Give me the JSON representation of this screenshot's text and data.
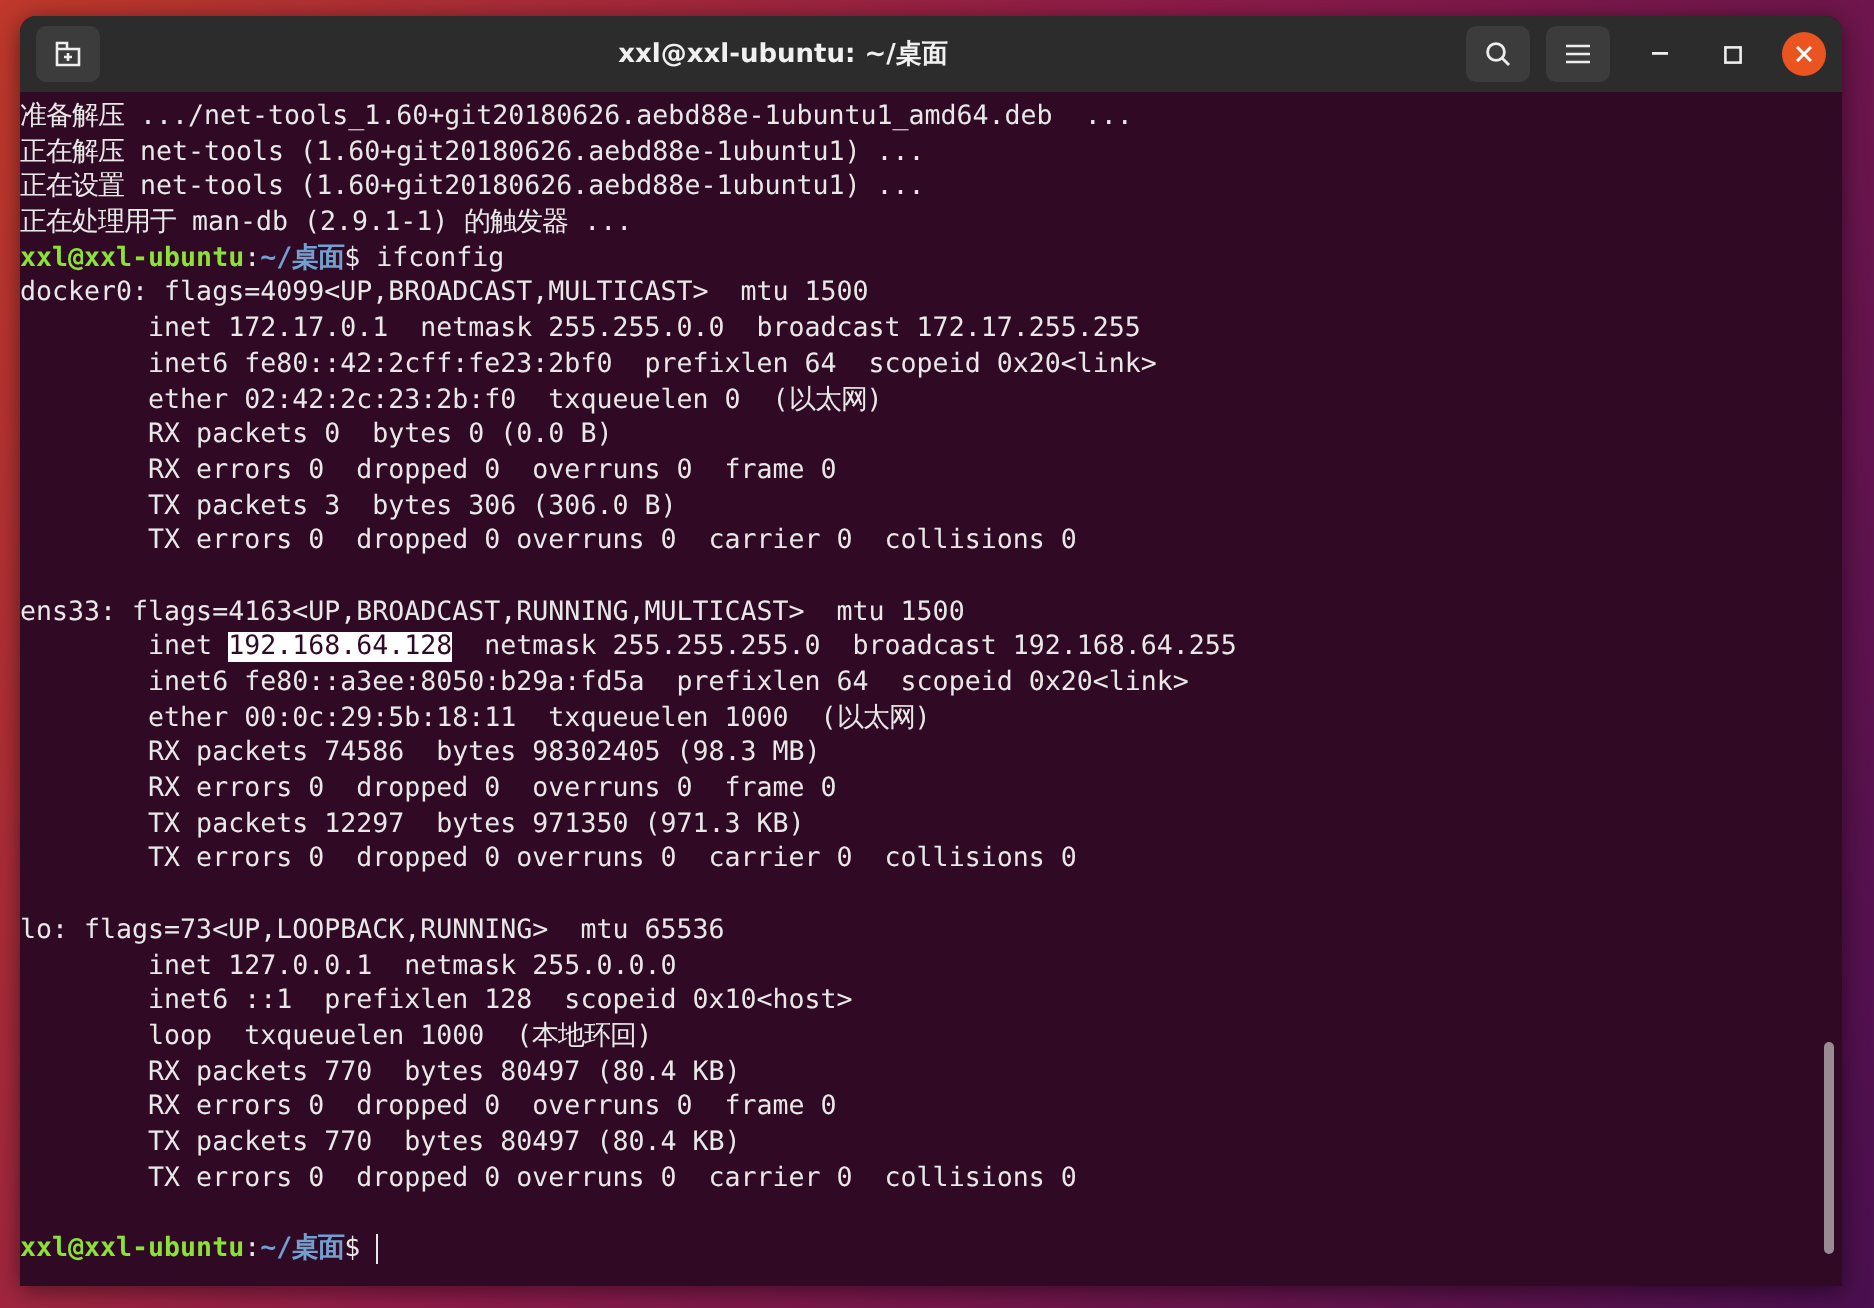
{
  "window": {
    "title": "xxl@xxl-ubuntu: ~/桌面"
  },
  "lines": [
    {
      "kind": "text",
      "segments": [
        {
          "kind": "plain",
          "text": "准备解压 .../net-tools_1.60+git20180626.aebd88e-1ubuntu1_amd64.deb  ..."
        }
      ]
    },
    {
      "kind": "text",
      "segments": [
        {
          "kind": "plain",
          "text": "正在解压 net-tools (1.60+git20180626.aebd88e-1ubuntu1) ..."
        }
      ]
    },
    {
      "kind": "text",
      "segments": [
        {
          "kind": "plain",
          "text": "正在设置 net-tools (1.60+git20180626.aebd88e-1ubuntu1) ..."
        }
      ]
    },
    {
      "kind": "text",
      "segments": [
        {
          "kind": "plain",
          "text": "正在处理用于 man-db (2.9.1-1) 的触发器 ..."
        }
      ]
    },
    {
      "kind": "text",
      "segments": [
        {
          "kind": "user",
          "text": "xxl@xxl-ubuntu"
        },
        {
          "kind": "plain",
          "text": ":"
        },
        {
          "kind": "path",
          "text": "~/桌面"
        },
        {
          "kind": "plain",
          "text": "$ ifconfig"
        }
      ]
    },
    {
      "kind": "text",
      "segments": [
        {
          "kind": "plain",
          "text": "docker0: flags=4099<UP,BROADCAST,MULTICAST>  mtu 1500"
        }
      ]
    },
    {
      "kind": "text",
      "segments": [
        {
          "kind": "plain",
          "text": "        inet 172.17.0.1  netmask 255.255.0.0  broadcast 172.17.255.255"
        }
      ]
    },
    {
      "kind": "text",
      "segments": [
        {
          "kind": "plain",
          "text": "        inet6 fe80::42:2cff:fe23:2bf0  prefixlen 64  scopeid 0x20<link>"
        }
      ]
    },
    {
      "kind": "text",
      "segments": [
        {
          "kind": "plain",
          "text": "        ether 02:42:2c:23:2b:f0  txqueuelen 0  (以太网)"
        }
      ]
    },
    {
      "kind": "text",
      "segments": [
        {
          "kind": "plain",
          "text": "        RX packets 0  bytes 0 (0.0 B)"
        }
      ]
    },
    {
      "kind": "text",
      "segments": [
        {
          "kind": "plain",
          "text": "        RX errors 0  dropped 0  overruns 0  frame 0"
        }
      ]
    },
    {
      "kind": "text",
      "segments": [
        {
          "kind": "plain",
          "text": "        TX packets 3  bytes 306 (306.0 B)"
        }
      ]
    },
    {
      "kind": "text",
      "segments": [
        {
          "kind": "plain",
          "text": "        TX errors 0  dropped 0 overruns 0  carrier 0  collisions 0"
        }
      ]
    },
    {
      "kind": "blank"
    },
    {
      "kind": "text",
      "segments": [
        {
          "kind": "plain",
          "text": "ens33: flags=4163<UP,BROADCAST,RUNNING,MULTICAST>  mtu 1500"
        }
      ]
    },
    {
      "kind": "text",
      "segments": [
        {
          "kind": "plain",
          "text": "        inet "
        },
        {
          "kind": "selection",
          "text": "192.168.64.128"
        },
        {
          "kind": "plain",
          "text": "  netmask 255.255.255.0  broadcast 192.168.64.255"
        }
      ]
    },
    {
      "kind": "text",
      "segments": [
        {
          "kind": "plain",
          "text": "        inet6 fe80::a3ee:8050:b29a:fd5a  prefixlen 64  scopeid 0x20<link>"
        }
      ]
    },
    {
      "kind": "text",
      "segments": [
        {
          "kind": "plain",
          "text": "        ether 00:0c:29:5b:18:11  txqueuelen 1000  (以太网)"
        }
      ]
    },
    {
      "kind": "text",
      "segments": [
        {
          "kind": "plain",
          "text": "        RX packets 74586  bytes 98302405 (98.3 MB)"
        }
      ]
    },
    {
      "kind": "text",
      "segments": [
        {
          "kind": "plain",
          "text": "        RX errors 0  dropped 0  overruns 0  frame 0"
        }
      ]
    },
    {
      "kind": "text",
      "segments": [
        {
          "kind": "plain",
          "text": "        TX packets 12297  bytes 971350 (971.3 KB)"
        }
      ]
    },
    {
      "kind": "text",
      "segments": [
        {
          "kind": "plain",
          "text": "        TX errors 0  dropped 0 overruns 0  carrier 0  collisions 0"
        }
      ]
    },
    {
      "kind": "blank"
    },
    {
      "kind": "text",
      "segments": [
        {
          "kind": "plain",
          "text": "lo: flags=73<UP,LOOPBACK,RUNNING>  mtu 65536"
        }
      ]
    },
    {
      "kind": "text",
      "segments": [
        {
          "kind": "plain",
          "text": "        inet 127.0.0.1  netmask 255.0.0.0"
        }
      ]
    },
    {
      "kind": "text",
      "segments": [
        {
          "kind": "plain",
          "text": "        inet6 ::1  prefixlen 128  scopeid 0x10<host>"
        }
      ]
    },
    {
      "kind": "text",
      "segments": [
        {
          "kind": "plain",
          "text": "        loop  txqueuelen 1000  (本地环回)"
        }
      ]
    },
    {
      "kind": "text",
      "segments": [
        {
          "kind": "plain",
          "text": "        RX packets 770  bytes 80497 (80.4 KB)"
        }
      ]
    },
    {
      "kind": "text",
      "segments": [
        {
          "kind": "plain",
          "text": "        RX errors 0  dropped 0  overruns 0  frame 0"
        }
      ]
    },
    {
      "kind": "text",
      "segments": [
        {
          "kind": "plain",
          "text": "        TX packets 770  bytes 80497 (80.4 KB)"
        }
      ]
    },
    {
      "kind": "text",
      "segments": [
        {
          "kind": "plain",
          "text": "        TX errors 0  dropped 0 overruns 0  carrier 0  collisions 0"
        }
      ]
    },
    {
      "kind": "blank"
    },
    {
      "kind": "text",
      "segments": [
        {
          "kind": "user",
          "text": "xxl@xxl-ubuntu"
        },
        {
          "kind": "plain",
          "text": ":"
        },
        {
          "kind": "path",
          "text": "~/桌面"
        },
        {
          "kind": "plain",
          "text": "$ "
        },
        {
          "kind": "cursor"
        }
      ]
    }
  ]
}
